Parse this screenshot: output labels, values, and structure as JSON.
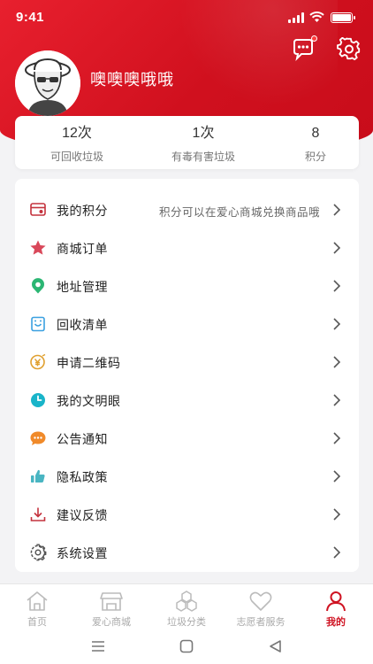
{
  "status_bar": {
    "time": "9:41"
  },
  "profile": {
    "username": "噢噢噢哦哦"
  },
  "stats": [
    {
      "value": "12次",
      "label": "可回收垃圾"
    },
    {
      "value": "1次",
      "label": "有毒有害垃圾"
    },
    {
      "value": "8",
      "label": "积分"
    }
  ],
  "menu": [
    {
      "label": "我的积分",
      "hint": "积分可以在爱心商城兑换商品哦",
      "icon": "points-card-icon",
      "color": "#c4323d"
    },
    {
      "label": "商城订单",
      "icon": "star-icon",
      "color": "#d9485a"
    },
    {
      "label": "地址管理",
      "icon": "location-icon",
      "color": "#2bb673"
    },
    {
      "label": "回收清单",
      "icon": "recycle-list-icon",
      "color": "#3aa0e0"
    },
    {
      "label": "申请二维码",
      "icon": "coin-icon",
      "color": "#e0a030"
    },
    {
      "label": "我的文明眼",
      "icon": "clock-icon",
      "color": "#19b4c9"
    },
    {
      "label": "公告通知",
      "icon": "chat-bubble-icon",
      "color": "#f08a2a"
    },
    {
      "label": "隐私政策",
      "icon": "thumbs-up-icon",
      "color": "#49b5c2"
    },
    {
      "label": "建议反馈",
      "icon": "download-icon",
      "color": "#c4323d"
    },
    {
      "label": "系统设置",
      "icon": "gear-icon",
      "color": "#555555"
    }
  ],
  "tabs": [
    {
      "label": "首页",
      "icon": "home-icon"
    },
    {
      "label": "爱心商城",
      "icon": "shop-icon"
    },
    {
      "label": "垃圾分类",
      "icon": "hexagons-icon"
    },
    {
      "label": "志愿者服务",
      "icon": "heart-icon"
    },
    {
      "label": "我的",
      "icon": "person-icon",
      "active": true
    }
  ],
  "colors": {
    "brand_red": "#d0101e",
    "active_tab": "#cf1322"
  }
}
